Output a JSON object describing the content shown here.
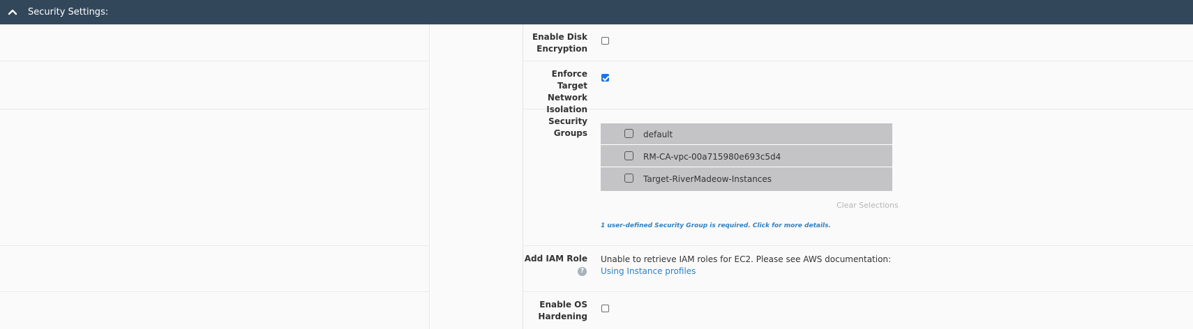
{
  "section": {
    "title": "Security Settings:",
    "collapse_icon": "chevron-up-icon"
  },
  "fields": {
    "disk_encryption": {
      "label_line1": "Enable Disk",
      "label_line2": "Encryption",
      "checked": false
    },
    "network_isolation": {
      "label_line1": "Enforce Target",
      "label_line2": "Network",
      "label_line3": "Isolation",
      "checked": true
    },
    "security_groups": {
      "label_line1": "Security",
      "label_line2": "Groups",
      "options": [
        {
          "label": "default",
          "checked": false
        },
        {
          "label": "RM-CA-vpc-00a715980e693c5d4",
          "checked": false
        },
        {
          "label": "Target-RiverMadeow-Instances",
          "checked": false
        }
      ],
      "clear_label": "Clear Selections",
      "hint": "1 user-defined Security Group is required. Click for more details."
    },
    "iam_role": {
      "label": "Add IAM Role",
      "help_icon": "question-circle-icon",
      "message": "Unable to retrieve IAM roles for EC2. Please see AWS documentation: ",
      "link_text": "Using Instance profiles"
    },
    "os_hardening": {
      "label_line1": "Enable OS",
      "label_line2": "Hardening",
      "checked": false
    }
  },
  "colors": {
    "header_bg": "#33475b",
    "checkbox_checked": "#1a73e8",
    "link": "#2f82c4",
    "list_bg": "#c4c4c6"
  }
}
